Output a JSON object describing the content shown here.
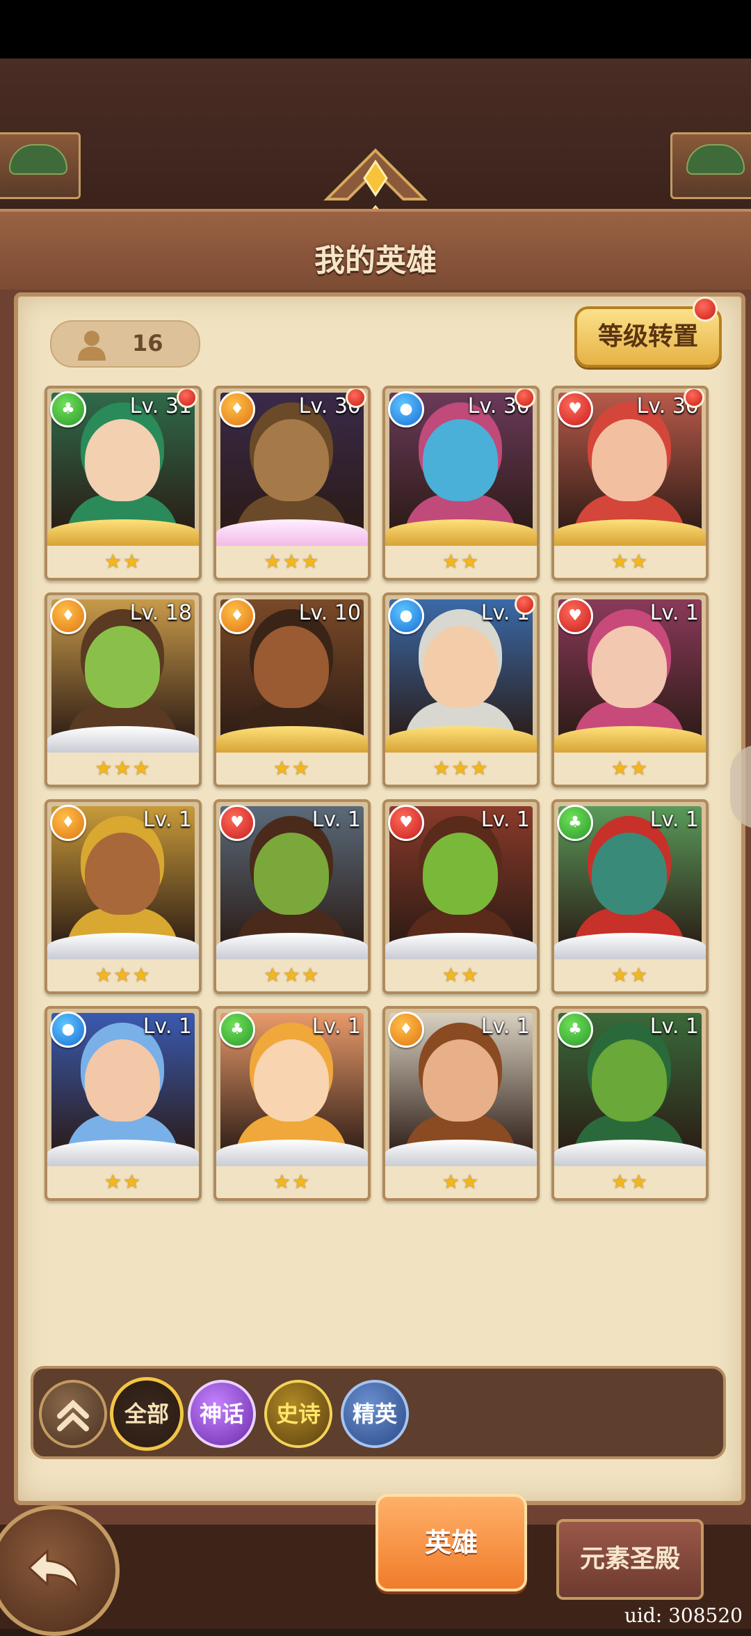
{
  "header": {
    "title": "我的英雄"
  },
  "hero_count": "16",
  "level_reset_label": "等级转置",
  "heroes": [
    {
      "level": "Lv. 31",
      "element": "green",
      "stars": "★★",
      "frame": "gold",
      "alert": true,
      "skin": "#f3d0b0",
      "hair": "#2a8a5a",
      "bg": "#2f6a4a"
    },
    {
      "level": "Lv. 30",
      "element": "orange",
      "stars": "★★★",
      "frame": "pink",
      "alert": true,
      "skin": "#a67a48",
      "hair": "#6a4a28",
      "bg": "#3a2a4a"
    },
    {
      "level": "Lv. 30",
      "element": "blue",
      "stars": "★★",
      "frame": "gold",
      "alert": true,
      "skin": "#4ab0d8",
      "hair": "#c04a7a",
      "bg": "#6a3a5a"
    },
    {
      "level": "Lv. 30",
      "element": "red",
      "stars": "★★",
      "frame": "gold",
      "alert": true,
      "skin": "#f2c0a0",
      "hair": "#d4453a",
      "bg": "#b85a4a"
    },
    {
      "level": "Lv. 18",
      "element": "orange",
      "stars": "★★★",
      "frame": "silver",
      "alert": false,
      "skin": "#8ac04a",
      "hair": "#5a3a22",
      "bg": "#c89a4a"
    },
    {
      "level": "Lv. 10",
      "element": "orange",
      "stars": "★★",
      "frame": "gold",
      "alert": false,
      "skin": "#9a5a32",
      "hair": "#3a2418",
      "bg": "#7a4a28"
    },
    {
      "level": "Lv. 1",
      "element": "blue",
      "stars": "★★★",
      "frame": "gold",
      "alert": true,
      "skin": "#f3ccaa",
      "hair": "#d8d8d0",
      "bg": "#3a6aa8"
    },
    {
      "level": "Lv. 1",
      "element": "red",
      "stars": "★★",
      "frame": "gold",
      "alert": false,
      "skin": "#f3c8b0",
      "hair": "#c84a7a",
      "bg": "#8a3a5a"
    },
    {
      "level": "Lv. 1",
      "element": "orange",
      "stars": "★★★",
      "frame": "silver",
      "alert": false,
      "skin": "#a8683a",
      "hair": "#d8a830",
      "bg": "#c89a3a"
    },
    {
      "level": "Lv. 1",
      "element": "red",
      "stars": "★★★",
      "frame": "silver",
      "alert": false,
      "skin": "#7aa83a",
      "hair": "#4a2a1a",
      "bg": "#5a6a7a"
    },
    {
      "level": "Lv. 1",
      "element": "red",
      "stars": "★★",
      "frame": "silver",
      "alert": false,
      "skin": "#7ab83a",
      "hair": "#5a2a1a",
      "bg": "#8a3a2a"
    },
    {
      "level": "Lv. 1",
      "element": "green",
      "stars": "★★",
      "frame": "silver",
      "alert": false,
      "skin": "#3a8a7a",
      "hair": "#c8302a",
      "bg": "#5a9a5a"
    },
    {
      "level": "Lv. 1",
      "element": "blue",
      "stars": "★★",
      "frame": "silver",
      "alert": false,
      "skin": "#f3c8a8",
      "hair": "#7ab0e8",
      "bg": "#3a5ab0"
    },
    {
      "level": "Lv. 1",
      "element": "green",
      "stars": "★★",
      "frame": "silver",
      "alert": false,
      "skin": "#f8d4b0",
      "hair": "#f0a83a",
      "bg": "#e89a6a"
    },
    {
      "level": "Lv. 1",
      "element": "orange",
      "stars": "★★",
      "frame": "silver",
      "alert": false,
      "skin": "#e8b088",
      "hair": "#8a4a22",
      "bg": "#d8d0c0"
    },
    {
      "level": "Lv. 1",
      "element": "green",
      "stars": "★★",
      "frame": "silver",
      "alert": false,
      "skin": "#6aa83a",
      "hair": "#2a6a3a",
      "bg": "#3a6a3a"
    }
  ],
  "filters": {
    "all": "全部",
    "myth": "神话",
    "epic": "史诗",
    "elite": "精英"
  },
  "tabs": {
    "heroes": "英雄",
    "element_temple": "元素圣殿"
  },
  "uid": "uid: 308520",
  "colors": {
    "accent_gold": "#f2c644",
    "panel": "#f1e3c2",
    "tab_active": "#f07c2a"
  }
}
